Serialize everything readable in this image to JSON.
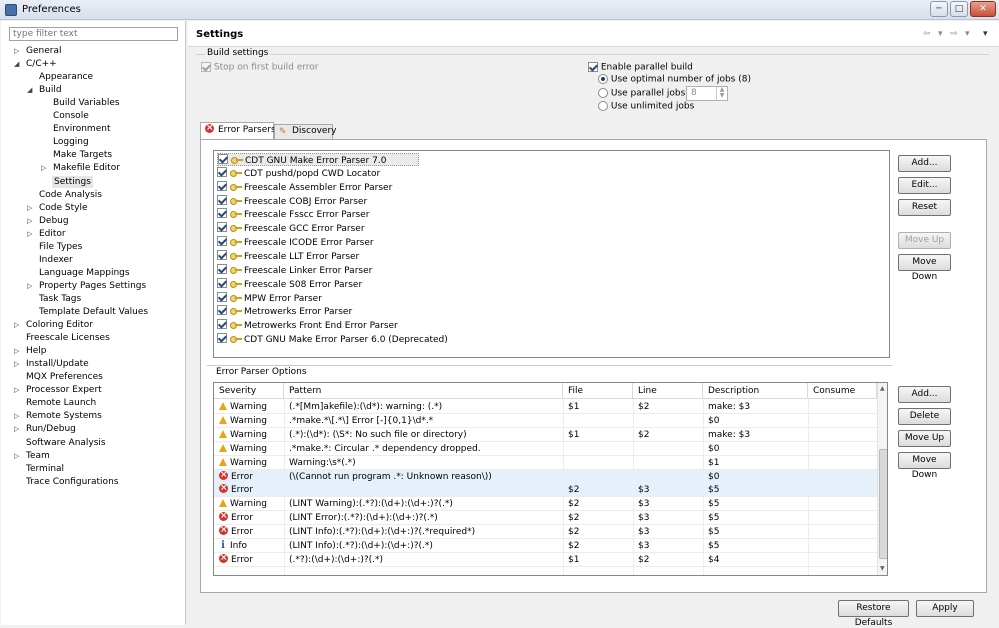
{
  "window": {
    "title": "Preferences",
    "minimize": "─",
    "maximize": "□",
    "close": "✕"
  },
  "filter": {
    "placeholder": "type filter text"
  },
  "tree": [
    {
      "label": "General",
      "twisty": "▷",
      "depth": 0
    },
    {
      "label": "C/C++",
      "twisty": "◢",
      "depth": 0
    },
    {
      "label": "Appearance",
      "twisty": "",
      "depth": 1
    },
    {
      "label": "Build",
      "twisty": "◢",
      "depth": 1
    },
    {
      "label": "Build Variables",
      "twisty": "",
      "depth": 2
    },
    {
      "label": "Console",
      "twisty": "",
      "depth": 2
    },
    {
      "label": "Environment",
      "twisty": "",
      "depth": 2
    },
    {
      "label": "Logging",
      "twisty": "",
      "depth": 2
    },
    {
      "label": "Make Targets",
      "twisty": "",
      "depth": 2
    },
    {
      "label": "Makefile Editor",
      "twisty": "▷",
      "depth": 2
    },
    {
      "label": "Settings",
      "twisty": "",
      "depth": 2,
      "selected": true
    },
    {
      "label": "Code Analysis",
      "twisty": "",
      "depth": 1
    },
    {
      "label": "Code Style",
      "twisty": "▷",
      "depth": 1
    },
    {
      "label": "Debug",
      "twisty": "▷",
      "depth": 1
    },
    {
      "label": "Editor",
      "twisty": "▷",
      "depth": 1
    },
    {
      "label": "File Types",
      "twisty": "",
      "depth": 1
    },
    {
      "label": "Indexer",
      "twisty": "",
      "depth": 1
    },
    {
      "label": "Language Mappings",
      "twisty": "",
      "depth": 1
    },
    {
      "label": "Property Pages Settings",
      "twisty": "▷",
      "depth": 1
    },
    {
      "label": "Task Tags",
      "twisty": "",
      "depth": 1
    },
    {
      "label": "Template Default Values",
      "twisty": "",
      "depth": 1
    },
    {
      "label": "Coloring Editor",
      "twisty": "▷",
      "depth": 0
    },
    {
      "label": "Freescale Licenses",
      "twisty": "",
      "depth": 0
    },
    {
      "label": "Help",
      "twisty": "▷",
      "depth": 0
    },
    {
      "label": "Install/Update",
      "twisty": "▷",
      "depth": 0
    },
    {
      "label": "MQX Preferences",
      "twisty": "",
      "depth": 0
    },
    {
      "label": "Processor Expert",
      "twisty": "▷",
      "depth": 0
    },
    {
      "label": "Remote Launch",
      "twisty": "",
      "depth": 0
    },
    {
      "label": "Remote Systems",
      "twisty": "▷",
      "depth": 0
    },
    {
      "label": "Run/Debug",
      "twisty": "▷",
      "depth": 0
    },
    {
      "label": "Software Analysis",
      "twisty": "",
      "depth": 0
    },
    {
      "label": "Team",
      "twisty": "▷",
      "depth": 0
    },
    {
      "label": "Terminal",
      "twisty": "",
      "depth": 0
    },
    {
      "label": "Trace Configurations",
      "twisty": "",
      "depth": 0
    }
  ],
  "header": {
    "title": "Settings",
    "back": "⇦",
    "fwd": "⇨",
    "menu": "▾"
  },
  "build": {
    "group_label": "Build settings",
    "stop_on_first": "Stop on first build error",
    "enable_parallel": "Enable parallel build",
    "optimal_jobs": "Use optimal number of jobs (8)",
    "parallel_jobs": "Use parallel jobs:",
    "parallel_jobs_value": "8",
    "unlimited_jobs": "Use unlimited jobs"
  },
  "tabs": {
    "error_parsers": "Error Parsers",
    "discovery": "Discovery"
  },
  "parsers": [
    "CDT GNU Make Error Parser 7.0",
    "CDT pushd/popd CWD Locator",
    "Freescale Assembler Error Parser",
    "Freescale COBJ Error Parser",
    "Freescale Fsscc Error Parser",
    "Freescale GCC Error Parser",
    "Freescale ICODE Error Parser",
    "Freescale LLT Error Parser",
    "Freescale Linker Error Parser",
    "Freescale S08 Error Parser",
    "MPW Error Parser",
    "Metrowerks Error Parser",
    "Metrowerks Front End Error Parser",
    "CDT GNU Make Error Parser 6.0 (Deprecated)"
  ],
  "parser_buttons": {
    "add": "Add...",
    "edit": "Edit...",
    "reset": "Reset",
    "move_up": "Move Up",
    "move_down": "Move Down"
  },
  "options": {
    "group_label": "Error Parser Options",
    "columns": [
      "Severity",
      "Pattern",
      "File",
      "Line",
      "Description",
      "Consume"
    ],
    "rows": [
      {
        "sev": "Warning",
        "icon": "warning-icon",
        "pattern": "(.*[Mm]akefile):(\\d*): warning: (.*)",
        "file": "$1",
        "line": "$2",
        "desc": "make: $3",
        "consume": ""
      },
      {
        "sev": "Warning",
        "icon": "warning-icon",
        "pattern": ".*make.*\\[.*\\] Error [-]{0,1}\\d*.*",
        "file": "",
        "line": "",
        "desc": "$0",
        "consume": ""
      },
      {
        "sev": "Warning",
        "icon": "warning-icon",
        "pattern": "(.*):(\\d*): (\\S*: No such file or directory)",
        "file": "$1",
        "line": "$2",
        "desc": "make: $3",
        "consume": ""
      },
      {
        "sev": "Warning",
        "icon": "warning-icon",
        "pattern": ".*make.*: Circular .* dependency dropped.",
        "file": "",
        "line": "",
        "desc": "$0",
        "consume": ""
      },
      {
        "sev": "Warning",
        "icon": "warning-icon",
        "pattern": "Warning:\\s*(.*)",
        "file": "",
        "line": "",
        "desc": "$1",
        "consume": ""
      },
      {
        "sev": "Error",
        "icon": "error-icon",
        "pattern": "(\\(Cannot run program .*: Unknown reason\\))",
        "file": "",
        "line": "",
        "desc": "$0",
        "consume": "",
        "highlight": true
      },
      {
        "sev": "Error",
        "icon": "error-icon",
        "pattern": "",
        "file": "$2",
        "line": "$3",
        "desc": "$5",
        "consume": "",
        "highlight": true
      },
      {
        "sev": "Warning",
        "icon": "warning-icon",
        "pattern": "(LINT Warning):(.*?):(\\d+):(\\d+:)?(.*)",
        "file": "$2",
        "line": "$3",
        "desc": "$5",
        "consume": ""
      },
      {
        "sev": "Error",
        "icon": "error-icon",
        "pattern": "(LINT Error):(.*?):(\\d+):(\\d+:)?(.*)",
        "file": "$2",
        "line": "$3",
        "desc": "$5",
        "consume": ""
      },
      {
        "sev": "Error",
        "icon": "error-icon",
        "pattern": "(LINT Info):(.*?):(\\d+):(\\d+:)?(.*required*)",
        "file": "$2",
        "line": "$3",
        "desc": "$5",
        "consume": ""
      },
      {
        "sev": "Info",
        "icon": "info-icon",
        "pattern": "(LINT Info):(.*?):(\\d+):(\\d+:)?(.*)",
        "file": "$2",
        "line": "$3",
        "desc": "$5",
        "consume": ""
      },
      {
        "sev": "Error",
        "icon": "error-icon",
        "pattern": "(.*?):(\\d+):(\\d+:)?(.*)",
        "file": "$1",
        "line": "$2",
        "desc": "$4",
        "consume": ""
      }
    ]
  },
  "option_buttons": {
    "add": "Add...",
    "delete": "Delete",
    "move_up": "Move Up",
    "move_down": "Move Down"
  },
  "footer": {
    "restore": "Restore Defaults",
    "apply": "Apply"
  }
}
